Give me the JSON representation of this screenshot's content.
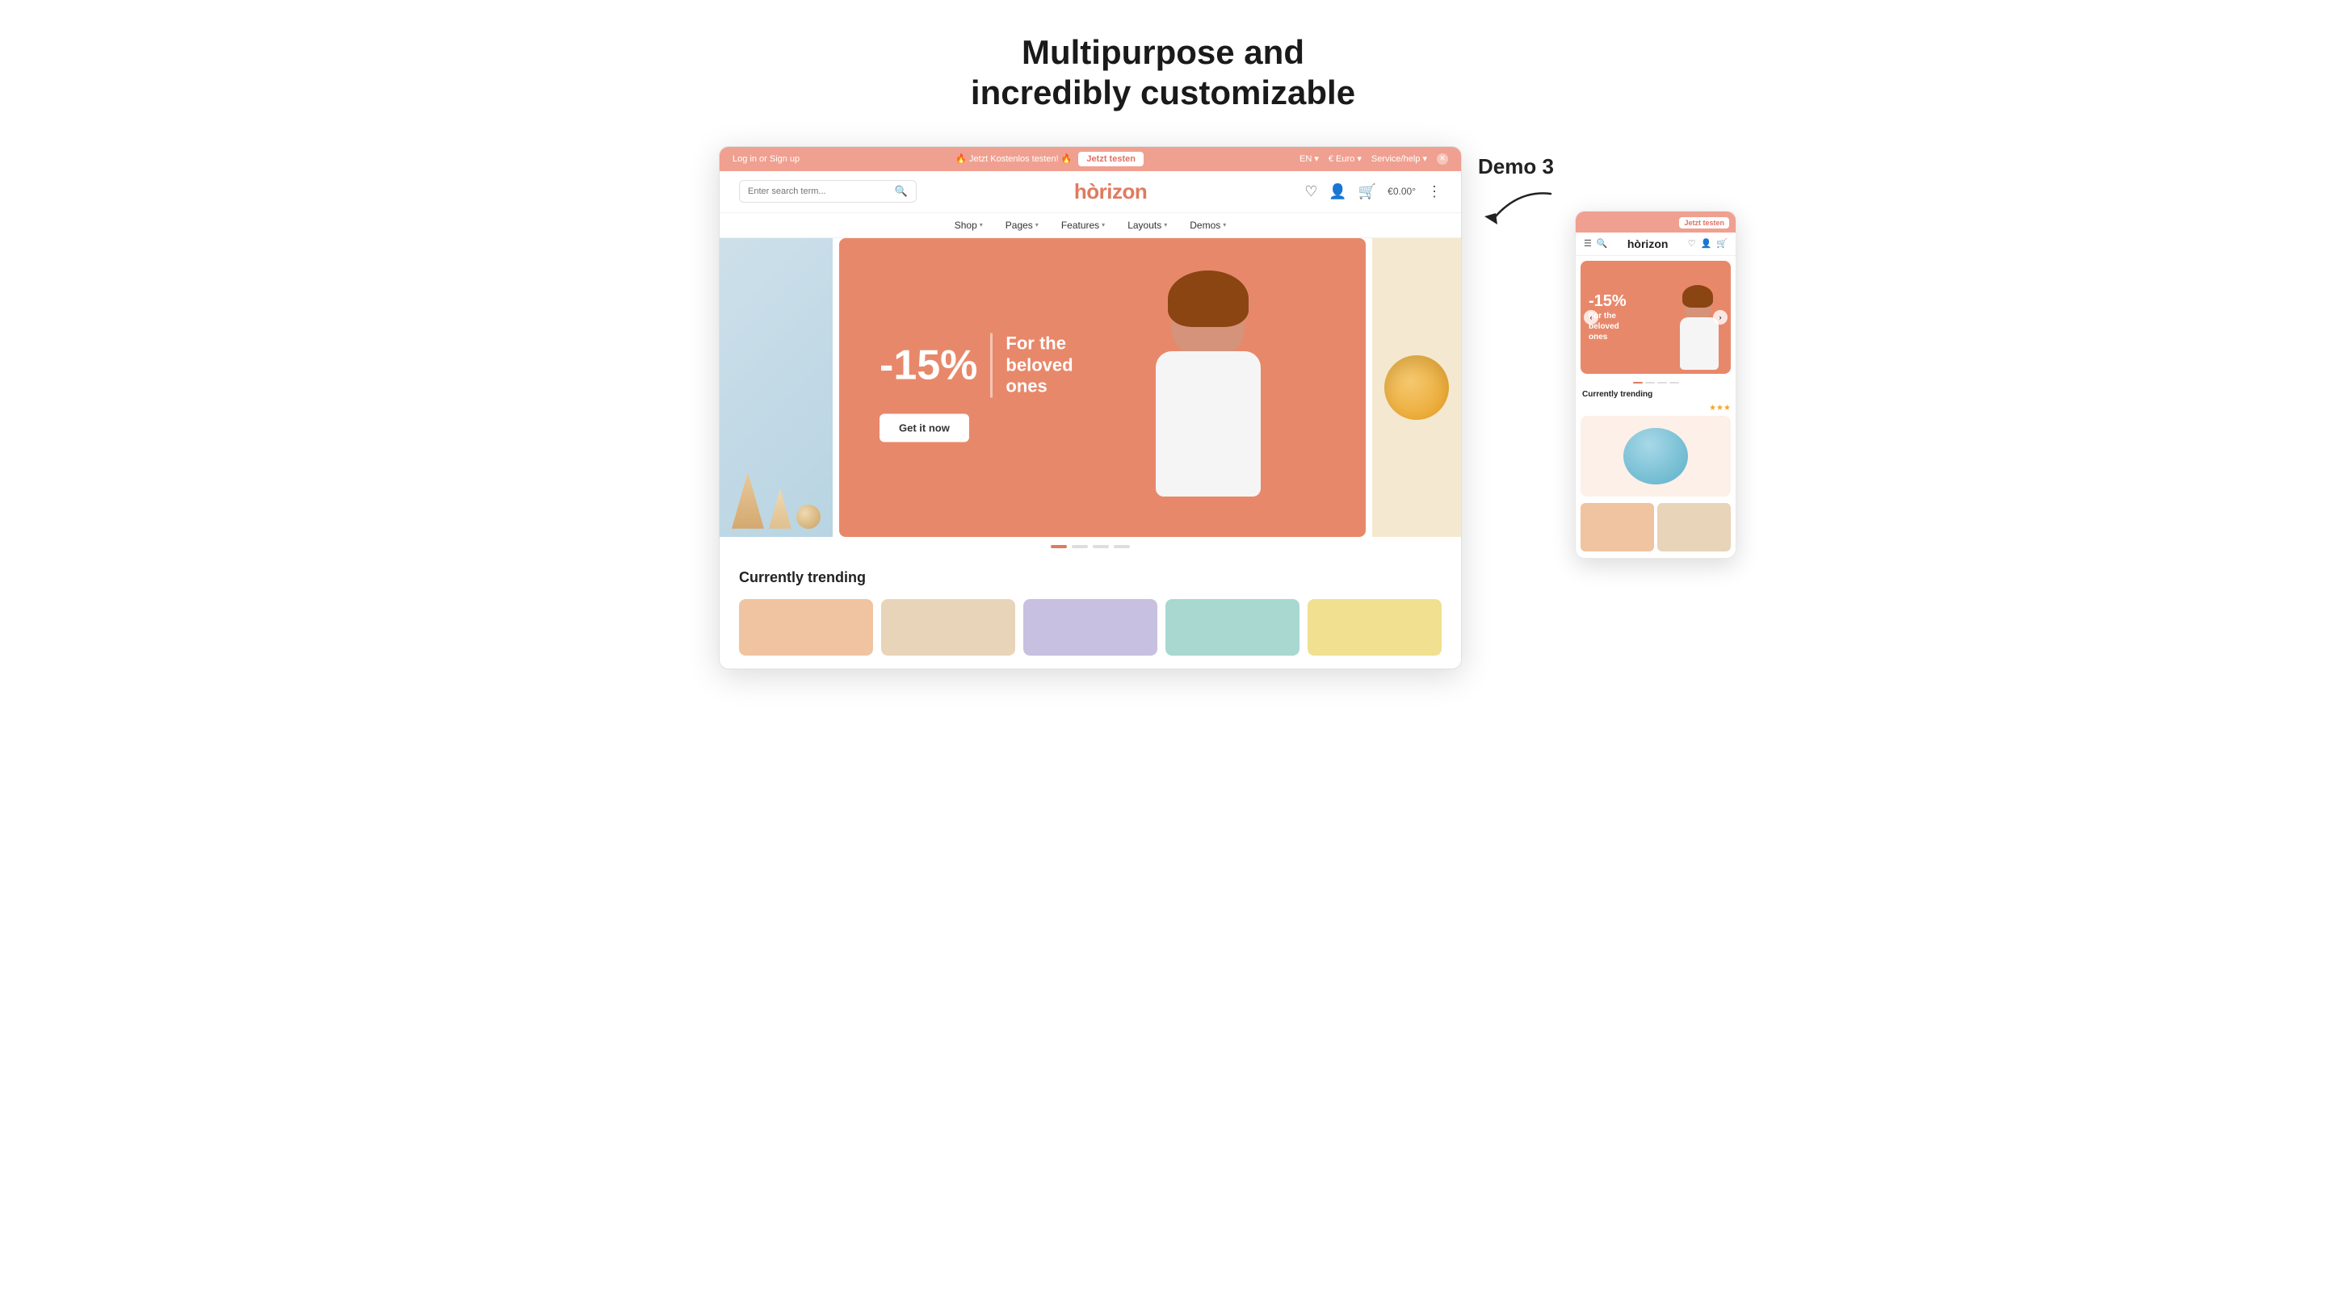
{
  "headline": {
    "line1": "Multipurpose and",
    "line2": "incredibly customizable"
  },
  "demo_label": "Demo 3",
  "topbar": {
    "left_text": "Log in or Sign up",
    "promo_text": "🔥 Jetzt Kostenlos testen! 🔥",
    "cta_label": "Jetzt testen",
    "lang": "EN ▾",
    "currency": "€ Euro ▾",
    "service": "Service/help ▾"
  },
  "header": {
    "search_placeholder": "Enter search term...",
    "logo": "hòrizon",
    "cart_price": "€0.00°"
  },
  "nav": {
    "items": [
      {
        "label": "Shop",
        "has_dropdown": true
      },
      {
        "label": "Pages",
        "has_dropdown": true
      },
      {
        "label": "Features",
        "has_dropdown": true
      },
      {
        "label": "Layouts",
        "has_dropdown": true
      },
      {
        "label": "Demos",
        "has_dropdown": true
      }
    ]
  },
  "hero": {
    "discount": "-15%",
    "tagline_line1": "For the",
    "tagline_line2": "beloved",
    "tagline_line3": "ones",
    "cta_label": "Get it now"
  },
  "carousel": {
    "dots": [
      true,
      false,
      false,
      false
    ]
  },
  "trending": {
    "title": "Currently trending",
    "cards": [
      {
        "color": "peach"
      },
      {
        "color": "sand"
      },
      {
        "color": "lavender"
      },
      {
        "color": "teal"
      },
      {
        "color": "yellow"
      }
    ]
  },
  "mobile": {
    "top_cta": "Jetzt testen",
    "logo": "hòrizon",
    "hero_discount": "-15%",
    "hero_tagline_line1": "For the",
    "hero_tagline_line2": "beloved",
    "hero_tagline_line3": "ones",
    "trending_title": "Currently trending",
    "stars": "★★★",
    "dots": [
      true,
      false,
      false,
      false
    ]
  }
}
